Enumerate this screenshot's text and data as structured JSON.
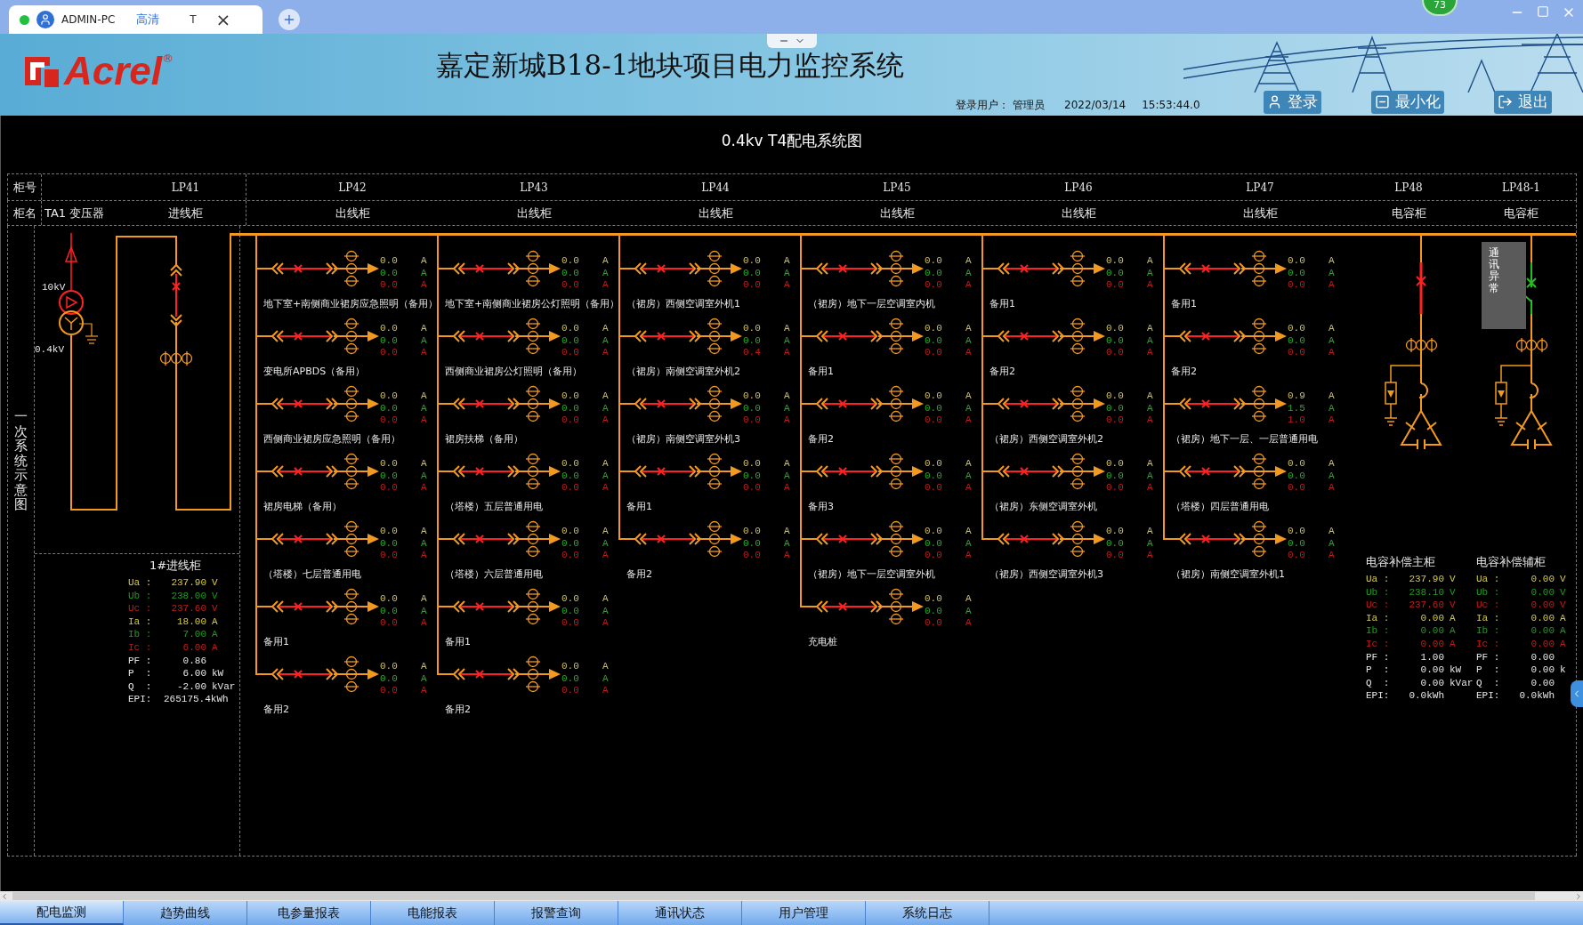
{
  "browser": {
    "tab_title": "ADMIN-PC",
    "quality": "高清",
    "tab_letter": "T",
    "close_glyph": "×",
    "badge": "73"
  },
  "header": {
    "logo": "Acrel",
    "registered": "®",
    "title": "嘉定新城B18-1地块项目电力监控系统",
    "login_label": "登录用户：",
    "user": "管理员",
    "date": "2022/03/14",
    "time": "15:53:44.0",
    "actions": [
      {
        "kind": "login",
        "label": "登录"
      },
      {
        "kind": "minimize",
        "label": "最小化"
      },
      {
        "kind": "exit",
        "label": "退出"
      }
    ]
  },
  "diagram": {
    "title": "0.4kv T4配电系统图",
    "row_labels": [
      "柜号",
      "柜名"
    ],
    "side_title": "一次系统示意图",
    "transformer": {
      "name": "TA1 变压器",
      "high_voltage": "10kV",
      "low_voltage": "0.4kV"
    },
    "incoming": {
      "number": "LP41",
      "type": "进线柜",
      "panel": {
        "title": "1#进线柜",
        "readings": [
          {
            "kind": "a",
            "label": "Ua :",
            "value": "237.90",
            "unit": "V"
          },
          {
            "kind": "b",
            "label": "Ub :",
            "value": "238.00",
            "unit": "V"
          },
          {
            "kind": "c",
            "label": "Uc :",
            "value": "237.60",
            "unit": "V"
          },
          {
            "kind": "a",
            "label": "Ia :",
            "value": "18.00",
            "unit": "A"
          },
          {
            "kind": "b",
            "label": "Ib :",
            "value": "7.00",
            "unit": "A"
          },
          {
            "kind": "c",
            "label": "Ic :",
            "value": "6.00",
            "unit": "A"
          },
          {
            "kind": "total",
            "label": "PF :",
            "value": "0.86"
          },
          {
            "kind": "total",
            "label": "P  :",
            "value": "6.00",
            "unit": "kW"
          },
          {
            "kind": "total",
            "label": "Q  :",
            "value": "-2.00",
            "unit": "kVar"
          },
          {
            "kind": "total",
            "label": "EPI:",
            "value": "265175.4kWh"
          }
        ]
      }
    },
    "feeder_cabinets": [
      {
        "number": "LP42",
        "type": "出线柜",
        "feeders": [
          {
            "name": "地下室+南侧商业裙房应急照明（备用）",
            "readings": [
              {
                "value": "0.0",
                "unit": "A"
              },
              {
                "value": "0.0",
                "unit": "A"
              },
              {
                "value": "0.0",
                "unit": "A"
              }
            ]
          },
          {
            "name": "变电所APBDS（备用）",
            "readings": [
              {
                "value": "0.0",
                "unit": "A"
              },
              {
                "value": "0.0",
                "unit": "A"
              },
              {
                "value": "0.0",
                "unit": "A"
              }
            ]
          },
          {
            "name": "西侧商业裙房应急照明（备用）",
            "readings": [
              {
                "value": "0.0",
                "unit": "A"
              },
              {
                "value": "0.0",
                "unit": "A"
              },
              {
                "value": "0.0",
                "unit": "A"
              }
            ]
          },
          {
            "name": "裙房电梯（备用）",
            "readings": [
              {
                "value": "0.0",
                "unit": "A"
              },
              {
                "value": "0.0",
                "unit": "A"
              },
              {
                "value": "0.0",
                "unit": "A"
              }
            ]
          },
          {
            "name": "（塔楼）七层普通用电",
            "readings": [
              {
                "value": "0.0",
                "unit": "A"
              },
              {
                "value": "0.0",
                "unit": "A"
              },
              {
                "value": "0.0",
                "unit": "A"
              }
            ]
          },
          {
            "name": "备用1",
            "readings": [
              {
                "value": "0.0",
                "unit": "A"
              },
              {
                "value": "0.0",
                "unit": "A"
              },
              {
                "value": "0.0",
                "unit": "A"
              }
            ]
          },
          {
            "name": "备用2",
            "readings": [
              {
                "value": "0.0",
                "unit": "A"
              },
              {
                "value": "0.0",
                "unit": "A"
              },
              {
                "value": "0.0",
                "unit": "A"
              }
            ]
          }
        ]
      },
      {
        "number": "LP43",
        "type": "出线柜",
        "feeders": [
          {
            "name": "地下室+南侧商业裙房公灯照明（备用）",
            "readings": [
              {
                "value": "0.0",
                "unit": "A"
              },
              {
                "value": "0.0",
                "unit": "A"
              },
              {
                "value": "0.0",
                "unit": "A"
              }
            ]
          },
          {
            "name": "西侧商业裙房公灯照明（备用）",
            "readings": [
              {
                "value": "0.0",
                "unit": "A"
              },
              {
                "value": "0.0",
                "unit": "A"
              },
              {
                "value": "0.0",
                "unit": "A"
              }
            ]
          },
          {
            "name": "裙房扶梯（备用）",
            "readings": [
              {
                "value": "0.0",
                "unit": "A"
              },
              {
                "value": "0.0",
                "unit": "A"
              },
              {
                "value": "0.0",
                "unit": "A"
              }
            ]
          },
          {
            "name": "（塔楼）五层普通用电",
            "readings": [
              {
                "value": "0.0",
                "unit": "A"
              },
              {
                "value": "0.0",
                "unit": "A"
              },
              {
                "value": "0.0",
                "unit": "A"
              }
            ]
          },
          {
            "name": "（塔楼）六层普通用电",
            "readings": [
              {
                "value": "0.0",
                "unit": "A"
              },
              {
                "value": "0.0",
                "unit": "A"
              },
              {
                "value": "0.0",
                "unit": "A"
              }
            ]
          },
          {
            "name": "备用1",
            "readings": [
              {
                "value": "0.0",
                "unit": "A"
              },
              {
                "value": "0.0",
                "unit": "A"
              },
              {
                "value": "0.0",
                "unit": "A"
              }
            ]
          },
          {
            "name": "备用2",
            "readings": [
              {
                "value": "0.0",
                "unit": "A"
              },
              {
                "value": "0.0",
                "unit": "A"
              },
              {
                "value": "0.0",
                "unit": "A"
              }
            ]
          }
        ]
      },
      {
        "number": "LP44",
        "type": "出线柜",
        "feeders": [
          {
            "name": "（裙房）西侧空调室外机1",
            "readings": [
              {
                "value": "0.0",
                "unit": "A"
              },
              {
                "value": "0.0",
                "unit": "A"
              },
              {
                "value": "0.0",
                "unit": "A"
              }
            ]
          },
          {
            "name": "（裙房）南侧空调室外机2",
            "readings": [
              {
                "value": "0.0",
                "unit": "A"
              },
              {
                "value": "0.0",
                "unit": "A"
              },
              {
                "value": "0.4",
                "unit": "A"
              }
            ]
          },
          {
            "name": "（裙房）南侧空调室外机3",
            "readings": [
              {
                "value": "0.0",
                "unit": "A"
              },
              {
                "value": "0.0",
                "unit": "A"
              },
              {
                "value": "0.0",
                "unit": "A"
              }
            ]
          },
          {
            "name": "备用1",
            "readings": [
              {
                "value": "0.0",
                "unit": "A"
              },
              {
                "value": "0.0",
                "unit": "A"
              },
              {
                "value": "0.0",
                "unit": "A"
              }
            ]
          },
          {
            "name": "备用2",
            "readings": [
              {
                "value": "0.0",
                "unit": "A"
              },
              {
                "value": "0.0",
                "unit": "A"
              },
              {
                "value": "0.0",
                "unit": "A"
              }
            ]
          }
        ]
      },
      {
        "number": "LP45",
        "type": "出线柜",
        "feeders": [
          {
            "name": "（裙房）地下一层空调室内机",
            "readings": [
              {
                "value": "0.0",
                "unit": "A"
              },
              {
                "value": "0.0",
                "unit": "A"
              },
              {
                "value": "0.0",
                "unit": "A"
              }
            ]
          },
          {
            "name": "备用1",
            "readings": [
              {
                "value": "0.0",
                "unit": "A"
              },
              {
                "value": "0.0",
                "unit": "A"
              },
              {
                "value": "0.0",
                "unit": "A"
              }
            ]
          },
          {
            "name": "备用2",
            "readings": [
              {
                "value": "0.0",
                "unit": "A"
              },
              {
                "value": "0.0",
                "unit": "A"
              },
              {
                "value": "0.0",
                "unit": "A"
              }
            ]
          },
          {
            "name": "备用3",
            "readings": [
              {
                "value": "0.0",
                "unit": "A"
              },
              {
                "value": "0.0",
                "unit": "A"
              },
              {
                "value": "0.0",
                "unit": "A"
              }
            ]
          },
          {
            "name": "（裙房）地下一层空调室外机",
            "readings": [
              {
                "value": "0.0",
                "unit": "A"
              },
              {
                "value": "0.0",
                "unit": "A"
              },
              {
                "value": "0.0",
                "unit": "A"
              }
            ]
          },
          {
            "name": "充电桩",
            "readings": [
              {
                "value": "0.0",
                "unit": "A"
              },
              {
                "value": "0.0",
                "unit": "A"
              },
              {
                "value": "0.0",
                "unit": "A"
              }
            ]
          }
        ]
      },
      {
        "number": "LP46",
        "type": "出线柜",
        "feeders": [
          {
            "name": "备用1",
            "readings": [
              {
                "value": "0.0",
                "unit": "A"
              },
              {
                "value": "0.0",
                "unit": "A"
              },
              {
                "value": "0.0",
                "unit": "A"
              }
            ]
          },
          {
            "name": "备用2",
            "readings": [
              {
                "value": "0.0",
                "unit": "A"
              },
              {
                "value": "0.0",
                "unit": "A"
              },
              {
                "value": "0.0",
                "unit": "A"
              }
            ]
          },
          {
            "name": "（裙房）西侧空调室外机2",
            "readings": [
              {
                "value": "0.0",
                "unit": "A"
              },
              {
                "value": "0.0",
                "unit": "A"
              },
              {
                "value": "0.0",
                "unit": "A"
              }
            ]
          },
          {
            "name": "（裙房）东侧空调室外机",
            "readings": [
              {
                "value": "0.0",
                "unit": "A"
              },
              {
                "value": "0.0",
                "unit": "A"
              },
              {
                "value": "0.0",
                "unit": "A"
              }
            ]
          },
          {
            "name": "（裙房）西侧空调室外机3",
            "readings": [
              {
                "value": "0.0",
                "unit": "A"
              },
              {
                "value": "0.0",
                "unit": "A"
              },
              {
                "value": "0.0",
                "unit": "A"
              }
            ]
          }
        ]
      },
      {
        "number": "LP47",
        "type": "出线柜",
        "feeders": [
          {
            "name": "备用1",
            "readings": [
              {
                "value": "0.0",
                "unit": "A"
              },
              {
                "value": "0.0",
                "unit": "A"
              },
              {
                "value": "0.0",
                "unit": "A"
              }
            ]
          },
          {
            "name": "备用2",
            "readings": [
              {
                "value": "0.0",
                "unit": "A"
              },
              {
                "value": "0.0",
                "unit": "A"
              },
              {
                "value": "0.0",
                "unit": "A"
              }
            ]
          },
          {
            "name": "（裙房）地下一层、一层普通用电",
            "readings": [
              {
                "value": "0.9",
                "unit": "A"
              },
              {
                "value": "1.5",
                "unit": "A"
              },
              {
                "value": "1.0",
                "unit": "A"
              }
            ]
          },
          {
            "name": "（塔楼）四层普通用电",
            "readings": [
              {
                "value": "0.0",
                "unit": "A"
              },
              {
                "value": "0.0",
                "unit": "A"
              },
              {
                "value": "0.0",
                "unit": "A"
              }
            ]
          },
          {
            "name": "（裙房）南侧空调室外机1",
            "readings": [
              {
                "value": "0.0",
                "unit": "A"
              },
              {
                "value": "0.0",
                "unit": "A"
              },
              {
                "value": "0.0",
                "unit": "A"
              }
            ]
          }
        ]
      }
    ],
    "capacitor_cabinets": [
      {
        "number": "LP48",
        "type": "电容柜",
        "breaker_closed": true,
        "panel": {
          "title": "电容补偿主柜",
          "readings": [
            {
              "kind": "a",
              "label": "Ua :",
              "value": "237.90",
              "unit": "V"
            },
            {
              "kind": "b",
              "label": "Ub :",
              "value": "238.10",
              "unit": "V"
            },
            {
              "kind": "c",
              "label": "Uc :",
              "value": "237.60",
              "unit": "V"
            },
            {
              "kind": "a",
              "label": "Ia :",
              "value": "0.00",
              "unit": "A"
            },
            {
              "kind": "b",
              "label": "Ib :",
              "value": "0.00",
              "unit": "A"
            },
            {
              "kind": "c",
              "label": "Ic :",
              "value": "0.00",
              "unit": "A"
            },
            {
              "kind": "total",
              "label": "PF :",
              "value": "1.00"
            },
            {
              "kind": "total",
              "label": "P  :",
              "value": "0.00",
              "unit": "kW"
            },
            {
              "kind": "total",
              "label": "Q  :",
              "value": "0.00",
              "unit": "kVar"
            },
            {
              "kind": "total",
              "label": "EPI:",
              "value": "0.0kWh"
            }
          ]
        }
      },
      {
        "number": "LP48-1",
        "type": "电容柜",
        "breaker_closed": false,
        "alarm": "通讯异常",
        "panel": {
          "title": "电容补偿辅柜",
          "readings": [
            {
              "kind": "a",
              "label": "Ua :",
              "value": "0.00",
              "unit": "V"
            },
            {
              "kind": "b",
              "label": "Ub :",
              "value": "0.00",
              "unit": "V"
            },
            {
              "kind": "c",
              "label": "Uc :",
              "value": "0.00",
              "unit": "V"
            },
            {
              "kind": "a",
              "label": "Ia :",
              "value": "0.00",
              "unit": "A"
            },
            {
              "kind": "b",
              "label": "Ib :",
              "value": "0.00",
              "unit": "A"
            },
            {
              "kind": "c",
              "label": "Ic :",
              "value": "0.00",
              "unit": "A"
            },
            {
              "kind": "total",
              "label": "PF :",
              "value": "0.00"
            },
            {
              "kind": "total",
              "label": "P  :",
              "value": "0.00",
              "unit": "k"
            },
            {
              "kind": "total",
              "label": "Q  :",
              "value": "0.00"
            },
            {
              "kind": "total",
              "label": "EPI:",
              "value": "0.0kWh"
            }
          ]
        }
      }
    ]
  },
  "tabs": [
    {
      "label": "配电监测",
      "selected": true
    },
    {
      "label": "趋势曲线",
      "selected": false
    },
    {
      "label": "电参量报表",
      "selected": false
    },
    {
      "label": "电能报表",
      "selected": false
    },
    {
      "label": "报警查询",
      "selected": false
    },
    {
      "label": "通讯状态",
      "selected": false
    },
    {
      "label": "用户管理",
      "selected": false
    },
    {
      "label": "系统日志",
      "selected": false
    }
  ]
}
